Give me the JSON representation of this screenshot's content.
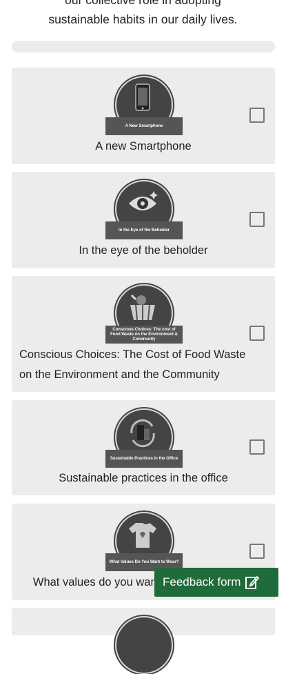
{
  "intro": {
    "line1": "our collective role in adopting",
    "line2": "sustainable habits in our daily lives."
  },
  "progress": {
    "value": 0
  },
  "cards": [
    {
      "title": "A new Smartphone",
      "badge": "A New Smartphone",
      "icon": "smartphone-icon",
      "checked": false
    },
    {
      "title": "In the eye of the beholder",
      "badge": "In the Eye of the Beholder",
      "icon": "eye-icon",
      "checked": false
    },
    {
      "title_line1": "Conscious Choices: The Cost of Food Waste",
      "title_line2": "on the Environment and the Community",
      "badge": "Conscious Choices: The cost of Food Waste on the Environment & Community",
      "icon": "food-basket-icon",
      "checked": false
    },
    {
      "title": "Sustainable practices in the office",
      "badge": "Sustainable Practices in the Office",
      "icon": "office-recycle-icon",
      "checked": false
    },
    {
      "title": "What values do you want to wear?",
      "badge": "What Values Do You Want to Wear?",
      "icon": "tshirt-icon",
      "checked": false
    }
  ],
  "feedback": {
    "label": "Feedback form",
    "icon": "edit-icon"
  }
}
